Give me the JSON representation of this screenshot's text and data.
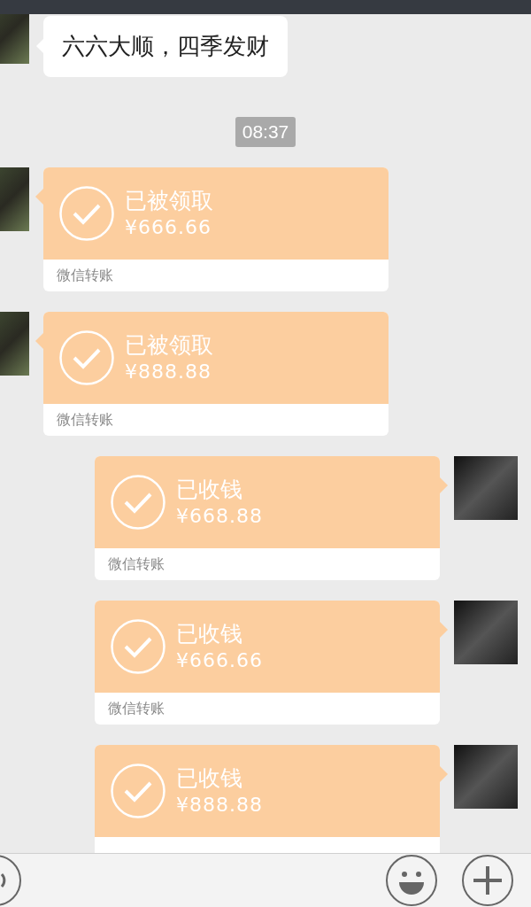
{
  "messages": [
    {
      "kind": "text",
      "sent": false,
      "text": "六六大顺，四季发财"
    },
    {
      "kind": "time",
      "text": "08:37"
    },
    {
      "kind": "transfer",
      "sent": false,
      "status": "已被领取",
      "amount": "¥666.66",
      "footer": "微信转账"
    },
    {
      "kind": "transfer",
      "sent": false,
      "status": "已被领取",
      "amount": "¥888.88",
      "footer": "微信转账"
    },
    {
      "kind": "transfer",
      "sent": true,
      "status": "已收钱",
      "amount": "¥668.88",
      "footer": "微信转账"
    },
    {
      "kind": "transfer",
      "sent": true,
      "status": "已收钱",
      "amount": "¥666.66",
      "footer": "微信转账"
    },
    {
      "kind": "transfer",
      "sent": true,
      "status": "已收钱",
      "amount": "¥888.88"
    }
  ]
}
